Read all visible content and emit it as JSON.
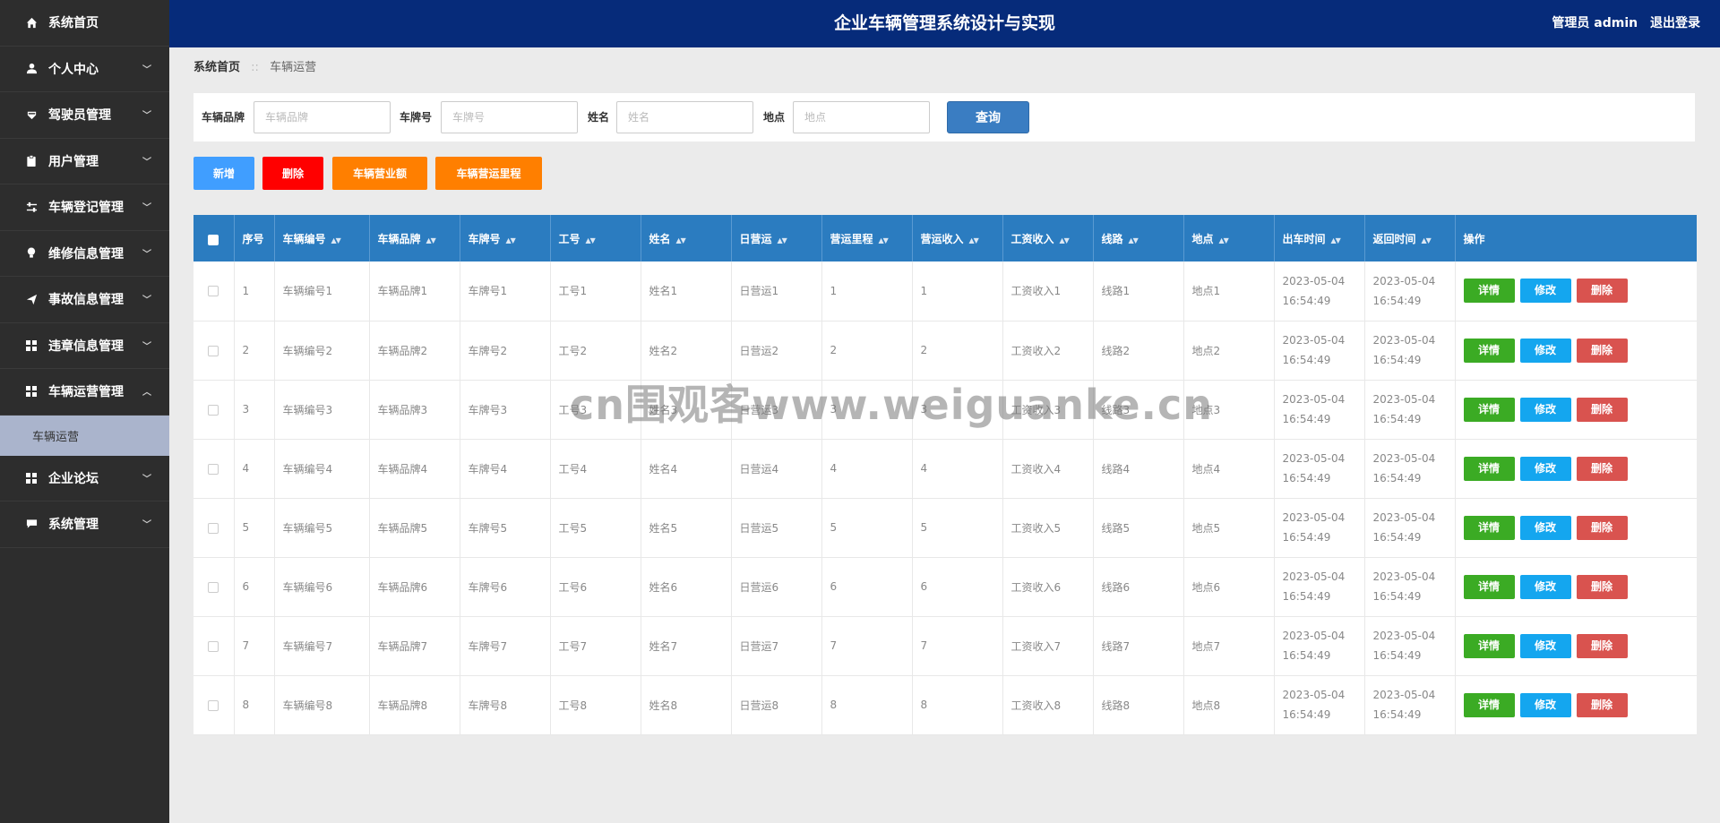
{
  "header": {
    "title": "企业车辆管理系统设计与实现",
    "user_label": "管理员 admin",
    "logout_label": "退出登录"
  },
  "sidebar": {
    "items": [
      {
        "label": "系统首页",
        "icon": "home-icon",
        "has_arrow": false
      },
      {
        "label": "个人中心",
        "icon": "user-icon",
        "has_arrow": true
      },
      {
        "label": "驾驶员管理",
        "icon": "driver-icon",
        "has_arrow": true
      },
      {
        "label": "用户管理",
        "icon": "clipboard-icon",
        "has_arrow": true
      },
      {
        "label": "车辆登记管理",
        "icon": "sliders-icon",
        "has_arrow": true
      },
      {
        "label": "维修信息管理",
        "icon": "bulb-icon",
        "has_arrow": true
      },
      {
        "label": "事故信息管理",
        "icon": "send-icon",
        "has_arrow": true
      },
      {
        "label": "违章信息管理",
        "icon": "grid-icon",
        "has_arrow": true
      },
      {
        "label": "车辆运营管理",
        "icon": "grid-icon",
        "has_arrow": true,
        "expanded": true
      },
      {
        "label": "企业论坛",
        "icon": "grid-icon",
        "has_arrow": true
      },
      {
        "label": "系统管理",
        "icon": "chat-icon",
        "has_arrow": true
      }
    ],
    "submenu": {
      "label": "车辆运营"
    }
  },
  "breadcrumb": {
    "home": "系统首页",
    "separator": "::",
    "current": "车辆运营"
  },
  "search": {
    "brand_label": "车辆品牌",
    "brand_placeholder": "车辆品牌",
    "brand_value": "",
    "plate_label": "车牌号",
    "plate_placeholder": "车牌号",
    "plate_value": "",
    "name_label": "姓名",
    "name_placeholder": "姓名",
    "name_value": "",
    "place_label": "地点",
    "place_placeholder": "地点",
    "place_value": "",
    "button_label": "查询"
  },
  "actions": {
    "add": "新增",
    "delete": "删除",
    "revenue": "车辆营业额",
    "mileage": "车辆营运里程"
  },
  "table": {
    "headers": [
      "序号",
      "车辆编号",
      "车辆品牌",
      "车牌号",
      "工号",
      "姓名",
      "日营运",
      "营运里程",
      "营运收入",
      "工资收入",
      "线路",
      "地点",
      "出车时间",
      "返回时间",
      "操作"
    ],
    "rows": [
      {
        "no": "1",
        "vehicle_no": "车辆编号1",
        "brand": "车辆品牌1",
        "plate": "车牌号1",
        "job_no": "工号1",
        "name": "姓名1",
        "daily": "日营运1",
        "mileage": "1",
        "income": "1",
        "wage": "工资收入1",
        "route": "线路1",
        "place": "地点1",
        "out_time": "2023-05-04 16:54:49",
        "back_time": "2023-05-04 16:54:49"
      },
      {
        "no": "2",
        "vehicle_no": "车辆编号2",
        "brand": "车辆品牌2",
        "plate": "车牌号2",
        "job_no": "工号2",
        "name": "姓名2",
        "daily": "日营运2",
        "mileage": "2",
        "income": "2",
        "wage": "工资收入2",
        "route": "线路2",
        "place": "地点2",
        "out_time": "2023-05-04 16:54:49",
        "back_time": "2023-05-04 16:54:49"
      },
      {
        "no": "3",
        "vehicle_no": "车辆编号3",
        "brand": "车辆品牌3",
        "plate": "车牌号3",
        "job_no": "工号3",
        "name": "姓名3",
        "daily": "日营运3",
        "mileage": "3",
        "income": "3",
        "wage": "工资收入3",
        "route": "线路3",
        "place": "地点3",
        "out_time": "2023-05-04 16:54:49",
        "back_time": "2023-05-04 16:54:49"
      },
      {
        "no": "4",
        "vehicle_no": "车辆编号4",
        "brand": "车辆品牌4",
        "plate": "车牌号4",
        "job_no": "工号4",
        "name": "姓名4",
        "daily": "日营运4",
        "mileage": "4",
        "income": "4",
        "wage": "工资收入4",
        "route": "线路4",
        "place": "地点4",
        "out_time": "2023-05-04 16:54:49",
        "back_time": "2023-05-04 16:54:49"
      },
      {
        "no": "5",
        "vehicle_no": "车辆编号5",
        "brand": "车辆品牌5",
        "plate": "车牌号5",
        "job_no": "工号5",
        "name": "姓名5",
        "daily": "日营运5",
        "mileage": "5",
        "income": "5",
        "wage": "工资收入5",
        "route": "线路5",
        "place": "地点5",
        "out_time": "2023-05-04 16:54:49",
        "back_time": "2023-05-04 16:54:49"
      },
      {
        "no": "6",
        "vehicle_no": "车辆编号6",
        "brand": "车辆品牌6",
        "plate": "车牌号6",
        "job_no": "工号6",
        "name": "姓名6",
        "daily": "日营运6",
        "mileage": "6",
        "income": "6",
        "wage": "工资收入6",
        "route": "线路6",
        "place": "地点6",
        "out_time": "2023-05-04 16:54:49",
        "back_time": "2023-05-04 16:54:49"
      },
      {
        "no": "7",
        "vehicle_no": "车辆编号7",
        "brand": "车辆品牌7",
        "plate": "车牌号7",
        "job_no": "工号7",
        "name": "姓名7",
        "daily": "日营运7",
        "mileage": "7",
        "income": "7",
        "wage": "工资收入7",
        "route": "线路7",
        "place": "地点7",
        "out_time": "2023-05-04 16:54:49",
        "back_time": "2023-05-04 16:54:49"
      },
      {
        "no": "8",
        "vehicle_no": "车辆编号8",
        "brand": "车辆品牌8",
        "plate": "车牌号8",
        "job_no": "工号8",
        "name": "姓名8",
        "daily": "日营运8",
        "mileage": "8",
        "income": "8",
        "wage": "工资收入8",
        "route": "线路8",
        "place": "地点8",
        "out_time": "2023-05-04 16:54:49",
        "back_time": "2023-05-04 16:54:49"
      }
    ],
    "row_buttons": {
      "detail": "详情",
      "edit": "修改",
      "delete": "删除"
    }
  },
  "watermark": "cn围观客www.weiguanke.cn",
  "colors": {
    "header_bg": "#062b7a",
    "sidebar_bg": "#2d2d2d",
    "table_header_bg": "#2b7cc0",
    "add_button": "#409eff",
    "delete_button": "#ff0000",
    "orange_button": "#ff7f00",
    "detail_button": "#3bab24",
    "edit_button": "#14a6ef",
    "row_delete_button": "#d9534f"
  }
}
